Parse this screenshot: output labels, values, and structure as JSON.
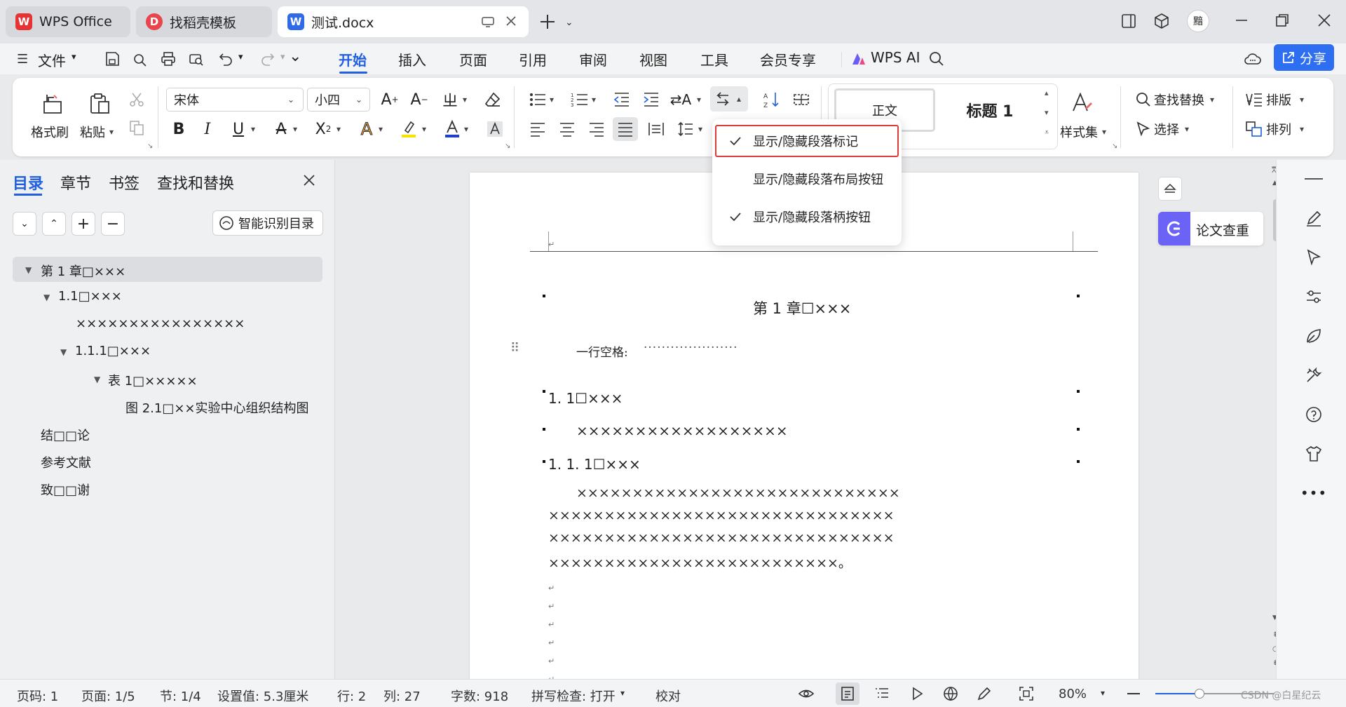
{
  "tabs": [
    {
      "label": "WPS Office",
      "state": "inactive"
    },
    {
      "label": "找稻壳模板",
      "state": "inactive"
    },
    {
      "label": "测试.docx",
      "state": "active"
    }
  ],
  "window": {
    "avatar_text": "黯"
  },
  "menu": {
    "file_label": "文件",
    "tabs": [
      "开始",
      "插入",
      "页面",
      "引用",
      "审阅",
      "视图",
      "工具",
      "会员专享"
    ],
    "active_tab": "开始",
    "ai_label": "WPS AI",
    "share_label": "分享"
  },
  "ribbon": {
    "format_painter": "格式刷",
    "paste": "粘贴",
    "font_name": "宋体",
    "font_size": "小四",
    "style_normal": "正文",
    "style_heading": "标题 1",
    "styles_label": "样式集",
    "find_replace": "查找替换",
    "select": "选择",
    "layout": "排版",
    "arrange": "排列"
  },
  "dropdown": {
    "items": [
      {
        "label": "显示/隐藏段落标记",
        "checked": true,
        "highlighted": true
      },
      {
        "label": "显示/隐藏段落布局按钮",
        "checked": false,
        "highlighted": false
      },
      {
        "label": "显示/隐藏段落柄按钮",
        "checked": true,
        "highlighted": false
      }
    ]
  },
  "left_panel": {
    "tabs": [
      "目录",
      "章节",
      "书签",
      "查找和替换"
    ],
    "active_tab": "目录",
    "smart_toc_label": "智能识别目录",
    "toc": [
      {
        "label": "第 1 章□×××",
        "level": 0,
        "expanded": true,
        "selected": true
      },
      {
        "label": "1.1□×××",
        "level": 1,
        "expanded": true,
        "selected": false
      },
      {
        "label": "××××××××××××××××",
        "level": 2,
        "expanded": null,
        "selected": false
      },
      {
        "label": "1.1.1□×××",
        "level": 2,
        "expanded": true,
        "selected": false
      },
      {
        "label": "表 1□×××××",
        "level": 3,
        "expanded": true,
        "selected": false
      },
      {
        "label": "图 2.1□××实验中心组织结构图",
        "level": 4,
        "expanded": null,
        "selected": false
      },
      {
        "label": "结□□论",
        "level": 0,
        "expanded": null,
        "selected": false
      },
      {
        "label": "参考文献",
        "level": 0,
        "expanded": null,
        "selected": false
      },
      {
        "label": "致□□谢",
        "level": 0,
        "expanded": null,
        "selected": false
      }
    ]
  },
  "document": {
    "header_mark": "↵",
    "chapter_title": "第 1 章☐×××",
    "blank_line_label": "一行空格:",
    "blank_line_dots": "·····················",
    "heading_1_1": "1. 1☐×××",
    "line_x": "××××××××××××××××××",
    "heading_1_1_1": "1. 1. 1☐×××",
    "body_lines": [
      "×××××××××××××××××××××××××××××",
      "×××××××××××××××××××××××××××××××",
      "×××××××××××××××××××××××××××××××",
      "××××××××××××××××××××××××××。"
    ]
  },
  "right_panel": {
    "plagiarism_label": "论文查重"
  },
  "status": {
    "page_code": "页码: 1",
    "page": "页面: 1/5",
    "section": "节: 1/4",
    "setting": "设置值: 5.3厘米",
    "row": "行: 2",
    "col": "列: 27",
    "words": "字数: 918",
    "spell": "拼写检查: 打开",
    "proof": "校对",
    "zoom": "80%",
    "watermark": "CSDN @白星纪云"
  },
  "colors": {
    "accent": "#1f5fe0",
    "highlight_border": "#e03b3b",
    "wps_red": "#e63434",
    "docer_red": "#e8454f",
    "writer_blue": "#2f6be6",
    "plagiarism_purple": "#6b63f5"
  }
}
